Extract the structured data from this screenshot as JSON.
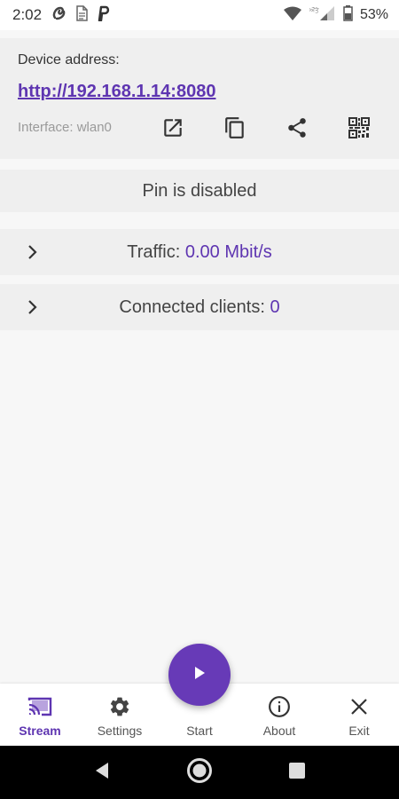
{
  "status_bar": {
    "time": "2:02",
    "battery_percent": "53%",
    "icons": [
      "app-icon",
      "document-icon",
      "paypal-icon",
      "wifi-icon",
      "signal-icon",
      "battery-icon"
    ]
  },
  "device": {
    "label": "Device address:",
    "url": "http://192.168.1.14:8080",
    "interface": "Interface: wlan0",
    "actions": [
      "open-in-browser-icon",
      "copy-icon",
      "share-icon",
      "qr-code-icon"
    ]
  },
  "pin": {
    "text": "Pin is disabled"
  },
  "traffic": {
    "label": "Traffic: ",
    "value": "0.00 Mbit/s"
  },
  "clients": {
    "label": "Connected clients: ",
    "value": "0"
  },
  "nav": {
    "items": [
      {
        "label": "Stream",
        "icon": "cast-icon",
        "active": true
      },
      {
        "label": "Settings",
        "icon": "gear-icon",
        "active": false
      },
      {
        "label": "Start",
        "icon": "play-icon",
        "active": false
      },
      {
        "label": "About",
        "icon": "info-icon",
        "active": false
      },
      {
        "label": "Exit",
        "icon": "close-icon",
        "active": false
      }
    ]
  },
  "colors": {
    "accent": "#673ab7",
    "link": "#5e35b1",
    "card": "#efefef",
    "background": "#f7f7f7"
  }
}
